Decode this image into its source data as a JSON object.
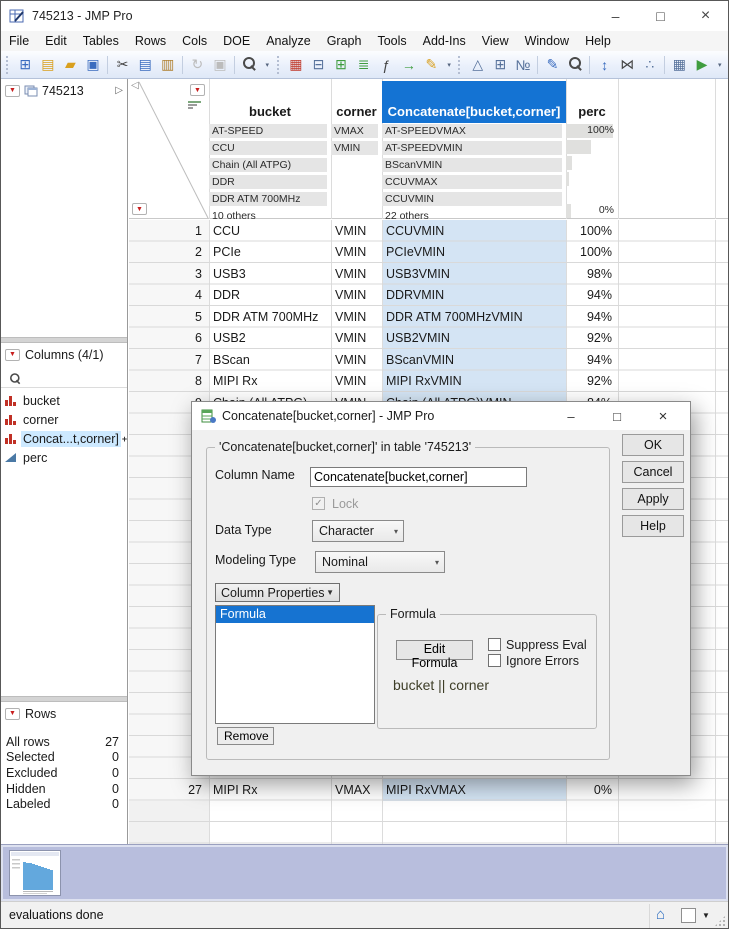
{
  "window": {
    "title": "745213 - JMP Pro",
    "controls": {
      "minimize": "–",
      "maximize": "□",
      "close": "×"
    }
  },
  "icons": {
    "red_triangle": "▼",
    "expand": "▷",
    "collapse": "◁",
    "combo_arrow": "▾",
    "menu_arrow": "▼",
    "home": "⌂",
    "status_dropdown": "▼",
    "check": "✓"
  },
  "menubar": [
    "File",
    "Edit",
    "Tables",
    "Rows",
    "Cols",
    "DOE",
    "Analyze",
    "Graph",
    "Tools",
    "Add-Ins",
    "View",
    "Window",
    "Help"
  ],
  "toolbar": {
    "items": [
      {
        "name": "toolbar-grip",
        "cls": "grip",
        "i": false
      },
      {
        "name": "new-data-table-icon",
        "glyph": "⊞",
        "cls": "c-blue",
        "i": true
      },
      {
        "name": "new-journal-icon",
        "glyph": "▤",
        "cls": "c-gold",
        "i": true
      },
      {
        "name": "open-icon",
        "glyph": "▰",
        "cls": "c-gold",
        "i": true
      },
      {
        "name": "save-icon",
        "glyph": "▣",
        "cls": "c-blue",
        "i": true
      },
      {
        "name": "toolbar-separator",
        "cls": "sep",
        "i": false
      },
      {
        "name": "cut-icon",
        "glyph": "✂",
        "cls": "c-dark",
        "i": true
      },
      {
        "name": "copy-icon",
        "glyph": "▤",
        "cls": "c-blue",
        "i": true
      },
      {
        "name": "paste-icon",
        "glyph": "▥",
        "cls": "c-brown",
        "i": true
      },
      {
        "name": "toolbar-separator",
        "cls": "sep",
        "i": false
      },
      {
        "name": "restore-icon",
        "glyph": "↻",
        "cls": "c-dis",
        "i": false
      },
      {
        "name": "lock-icon",
        "glyph": "▣",
        "cls": "c-dis",
        "i": false
      },
      {
        "name": "toolbar-separator",
        "cls": "sep",
        "i": false
      },
      {
        "name": "search-icon",
        "glyph": "",
        "cls": "mag",
        "i": true
      },
      {
        "name": "toolbar-overflow-icon",
        "glyph": "▾",
        "cls": "ov",
        "i": true
      },
      {
        "name": "toolbar-grip",
        "cls": "grip",
        "i": false
      },
      {
        "name": "data-table-icon",
        "glyph": "▦",
        "cls": "c-red",
        "i": true
      },
      {
        "name": "tabulate-icon",
        "glyph": "⊟",
        "cls": "c-slate",
        "i": true
      },
      {
        "name": "split-table-icon",
        "glyph": "⊞",
        "cls": "c-green",
        "i": true
      },
      {
        "name": "sort-table-icon",
        "glyph": "≣",
        "cls": "c-green",
        "i": true
      },
      {
        "name": "formula-icon",
        "glyph": "ƒ",
        "cls": "c-dark",
        "i": true
      },
      {
        "name": "join-tables-icon",
        "glyph": "→",
        "cls": "c-green",
        "i": true
      },
      {
        "name": "edit-script-icon",
        "glyph": "✎",
        "cls": "c-gold",
        "i": true
      },
      {
        "name": "toolbar-overflow-icon",
        "glyph": "▾",
        "cls": "ov",
        "i": true
      },
      {
        "name": "toolbar-grip",
        "cls": "grip",
        "i": false
      },
      {
        "name": "clear-row-states-icon",
        "glyph": "△",
        "cls": "c-slate",
        "i": true
      },
      {
        "name": "add-rows-icon",
        "glyph": "⊞",
        "cls": "c-slate",
        "i": true
      },
      {
        "name": "recode-icon",
        "glyph": "№",
        "cls": "c-slate",
        "i": true
      },
      {
        "name": "toolbar-separator",
        "cls": "sep",
        "i": false
      },
      {
        "name": "column-info-icon",
        "glyph": "✎",
        "cls": "c-blue",
        "i": true
      },
      {
        "name": "preview-icon",
        "glyph": "",
        "cls": "mag",
        "i": true
      },
      {
        "name": "toolbar-separator",
        "cls": "sep",
        "i": false
      },
      {
        "name": "sort-columns-icon",
        "glyph": "↕",
        "cls": "c-blue",
        "i": true
      },
      {
        "name": "join-columns-icon",
        "glyph": "⋈",
        "cls": "c-dark",
        "i": true
      },
      {
        "name": "tree-view-icon",
        "glyph": "∴",
        "cls": "c-slate",
        "i": true
      },
      {
        "name": "toolbar-separator",
        "cls": "sep",
        "i": false
      },
      {
        "name": "calculator-icon",
        "glyph": "▦",
        "cls": "c-slate",
        "i": true
      },
      {
        "name": "run-script-icon",
        "glyph": "▶",
        "cls": "c-green",
        "i": true
      },
      {
        "name": "toolbar-overflow-icon",
        "glyph": "▾",
        "cls": "ov",
        "i": true
      }
    ]
  },
  "sidebar": {
    "tables_panel": {
      "title": "745213"
    },
    "columns_panel": {
      "title": "Columns (4/1)",
      "items": [
        {
          "label": "bucket",
          "type": "nominal"
        },
        {
          "label": "corner",
          "type": "nominal"
        },
        {
          "label": "Concat...t,corner]",
          "type": "nominal",
          "selected": true,
          "formula": true,
          "badge": "+"
        },
        {
          "label": "perc",
          "type": "continuous"
        }
      ]
    },
    "rows_panel": {
      "title": "Rows",
      "stats": [
        {
          "label": "All rows",
          "value": "27"
        },
        {
          "label": "Selected",
          "value": "0"
        },
        {
          "label": "Excluded",
          "value": "0"
        },
        {
          "label": "Hidden",
          "value": "0"
        },
        {
          "label": "Labeled",
          "value": "0"
        }
      ]
    }
  },
  "table": {
    "columns": [
      {
        "label": "bucket"
      },
      {
        "label": "corner"
      },
      {
        "label": "Concatenate[bucket,corner]",
        "selected": true
      },
      {
        "label": "perc"
      }
    ],
    "filters": {
      "bucket": [
        {
          "label": "AT-SPEED"
        },
        {
          "label": "CCU"
        },
        {
          "label": "Chain (All ATPG)"
        },
        {
          "label": "DDR"
        },
        {
          "label": "DDR ATM 700MHz"
        },
        {
          "label": "10 others",
          "others": true
        }
      ],
      "corner": [
        {
          "label": "VMAX"
        },
        {
          "label": "VMIN"
        }
      ],
      "concat": [
        {
          "label": "AT-SPEEDVMAX"
        },
        {
          "label": "AT-SPEEDVMIN"
        },
        {
          "label": "BScanVMIN"
        },
        {
          "label": "CCUVMAX"
        },
        {
          "label": "CCUVMIN"
        },
        {
          "label": "22 others",
          "others": true
        }
      ],
      "perc_histogram": [
        {
          "label": "100%",
          "w": 90
        },
        {
          "w": 48
        },
        {
          "w": 12
        },
        {
          "w": 5
        },
        {
          "w": 0
        },
        {
          "label": "0%",
          "w": 9
        }
      ]
    },
    "rows": [
      {
        "n": "1",
        "bucket": "CCU",
        "corner": "VMIN",
        "concat": "CCUVMIN",
        "perc": "100%"
      },
      {
        "n": "2",
        "bucket": "PCIe",
        "corner": "VMIN",
        "concat": "PCIeVMIN",
        "perc": "100%"
      },
      {
        "n": "3",
        "bucket": "USB3",
        "corner": "VMIN",
        "concat": "USB3VMIN",
        "perc": "98%"
      },
      {
        "n": "4",
        "bucket": "DDR",
        "corner": "VMIN",
        "concat": "DDRVMIN",
        "perc": "94%"
      },
      {
        "n": "5",
        "bucket": "DDR ATM 700MHz",
        "corner": "VMIN",
        "concat": "DDR ATM 700MHzVMIN",
        "perc": "94%"
      },
      {
        "n": "6",
        "bucket": "USB2",
        "corner": "VMIN",
        "concat": "USB2VMIN",
        "perc": "92%"
      },
      {
        "n": "7",
        "bucket": "BScan",
        "corner": "VMIN",
        "concat": "BScanVMIN",
        "perc": "94%"
      },
      {
        "n": "8",
        "bucket": "MIPI Rx",
        "corner": "VMIN",
        "concat": "MIPI RxVMIN",
        "perc": "92%"
      },
      {
        "n": "9",
        "bucket": "Chain (All ATPG)",
        "corner": "VMIN",
        "concat": "Chain (All ATPG)VMIN",
        "perc": "84%"
      }
    ],
    "row27": {
      "n": "27",
      "bucket": "MIPI Rx",
      "corner": "VMAX",
      "concat": "MIPI RxVMAX",
      "perc": "0%"
    }
  },
  "dialog": {
    "title": "Concatenate[bucket,corner] - JMP Pro",
    "controls": {
      "minimize": "–",
      "maximize": "□",
      "close": "×"
    },
    "group_title": "'Concatenate[bucket,corner]' in table '745213'",
    "column_name_label": "Column Name",
    "column_name_value": "Concatenate[bucket,corner]",
    "lock_label": "Lock",
    "data_type_label": "Data Type",
    "data_type_value": "Character",
    "modeling_type_label": "Modeling Type",
    "modeling_type_value": "Nominal",
    "column_properties_label": "Column Properties",
    "properties": [
      {
        "label": "Formula",
        "selected": true
      }
    ],
    "formula_group": {
      "title": "Formula",
      "edit_button": "Edit Formula",
      "suppress_label": "Suppress Eval",
      "ignore_label": "Ignore Errors",
      "expression": "bucket || corner"
    },
    "remove_button": "Remove",
    "buttons": [
      "OK",
      "Cancel",
      "Apply",
      "Help"
    ]
  },
  "statusbar": {
    "message": "evaluations done"
  }
}
